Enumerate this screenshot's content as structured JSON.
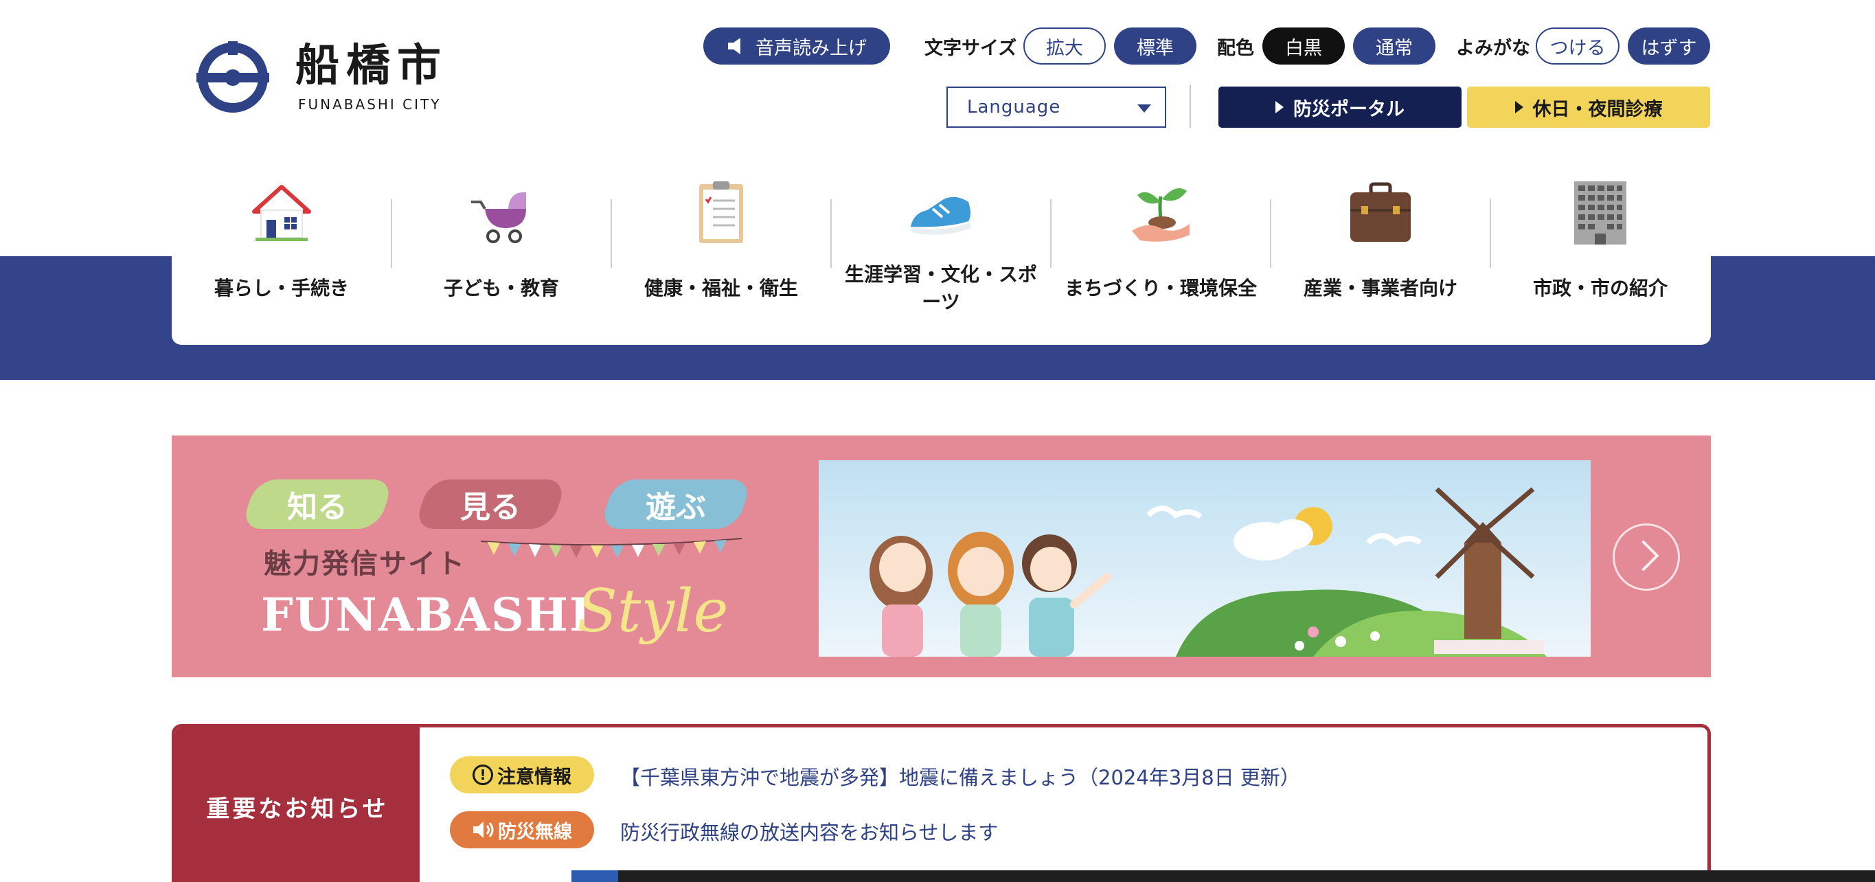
{
  "header": {
    "logo_name": "船橋市",
    "logo_en": "FUNABASHI CITY",
    "voice_button": "音声読み上げ",
    "text_size_label": "文字サイズ",
    "text_size_options": [
      "拡大",
      "標準"
    ],
    "color_label": "配色",
    "color_options": [
      "白黒",
      "通常"
    ],
    "furigana_label": "よみがな",
    "furigana_options": [
      "つける",
      "はずす"
    ],
    "language_select": "Language",
    "disaster_portal": "防災ポータル",
    "holiday_clinic": "休日・夜間診療"
  },
  "nav": {
    "items": [
      {
        "label": "暮らし・手続き",
        "icon": "house-icon"
      },
      {
        "label": "子ども・教育",
        "icon": "stroller-icon"
      },
      {
        "label": "健康・福祉・衛生",
        "icon": "clipboard-icon"
      },
      {
        "label": "生涯学習・文化・スポーツ",
        "icon": "sneaker-icon"
      },
      {
        "label": "まちづくり・環境保全",
        "icon": "sprout-icon"
      },
      {
        "label": "産業・事業者向け",
        "icon": "briefcase-icon"
      },
      {
        "label": "市政・市の紹介",
        "icon": "building-icon"
      }
    ]
  },
  "banner": {
    "tags": [
      "知る",
      "見る",
      "遊ぶ"
    ],
    "site_label": "魅力発信サイト",
    "brand": "FUNABASHI",
    "brand_script": "Style"
  },
  "notice": {
    "heading": "重要なお知らせ",
    "items": [
      {
        "tag": "注意情報",
        "text": "【千葉県東方沖で地震が多発】地震に備えましょう（2024年3月8日 更新）"
      },
      {
        "tag": "防災無線",
        "text": "防災行政無線の放送内容をお知らせします"
      }
    ]
  },
  "colors": {
    "navy": "#2f4285",
    "band": "#34448a",
    "banner_pink": "#e48a96",
    "notice_red": "#a52f3d",
    "caution_yellow": "#f3d45a",
    "radio_orange": "#e07a3f"
  }
}
